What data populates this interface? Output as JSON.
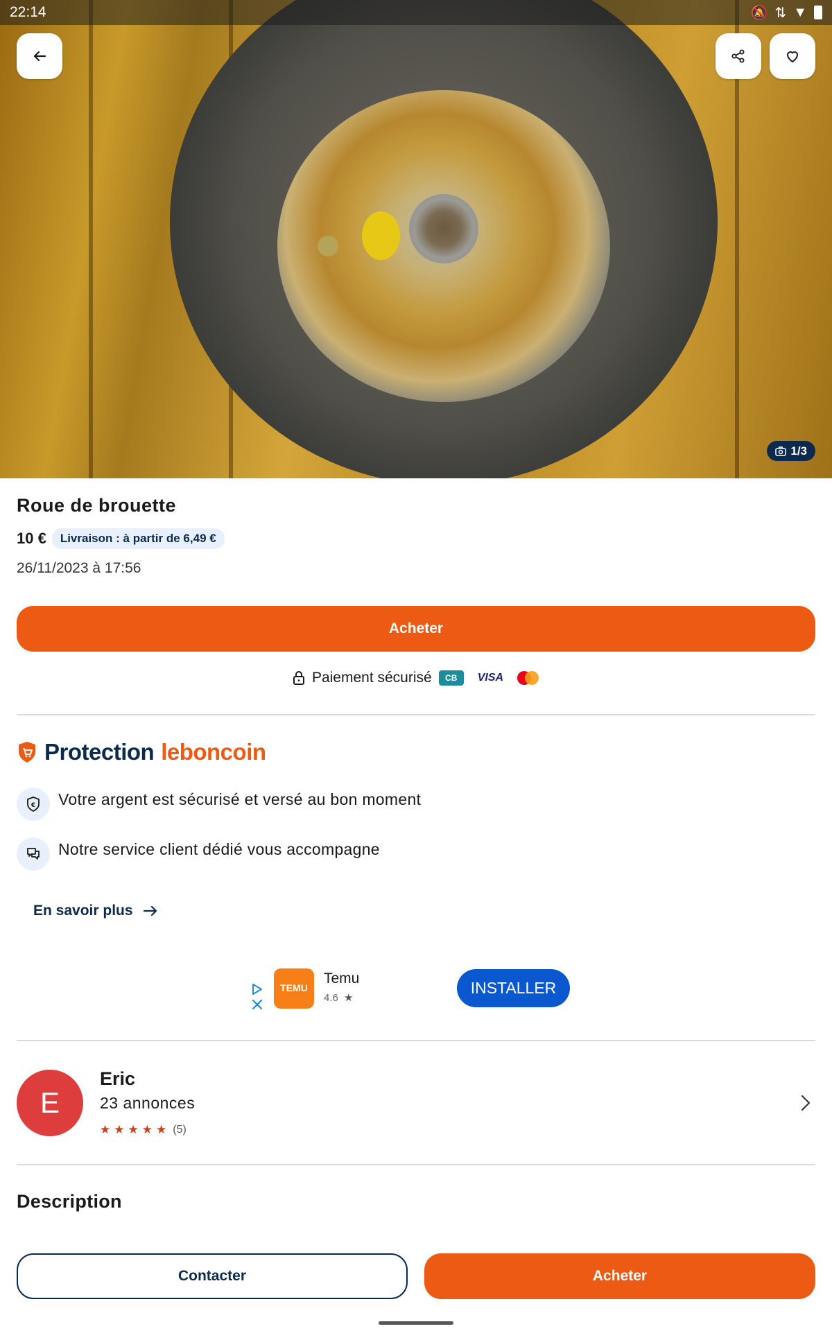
{
  "status_bar": {
    "time": "22:14"
  },
  "hero": {
    "photo_count": "1/3"
  },
  "listing": {
    "title": "Roue de brouette",
    "price": "10 €",
    "delivery": "Livraison : à partir de 6,49 €",
    "date": "26/11/2023 à 17:56"
  },
  "buy_button_label": "Acheter",
  "payment": {
    "label": "Paiement sécurisé",
    "cb": "CB",
    "visa": "VISA"
  },
  "protection": {
    "title_part1": "Protection",
    "title_part2": "leboncoin",
    "items": [
      {
        "icon": "euro-shield-icon",
        "text": "Votre argent est sécurisé et versé au bon moment"
      },
      {
        "icon": "chat-icon",
        "text": "Notre service client dédié vous accompagne"
      }
    ],
    "learn_more": "En savoir plus"
  },
  "ad": {
    "app_name": "Temu",
    "rating": "4.6",
    "logo_text": "TEMU",
    "install_label": "INSTALLER"
  },
  "seller": {
    "initial": "E",
    "name": "Eric",
    "ads_count": "23 annonces",
    "stars": 5,
    "reviews": "(5)"
  },
  "description_heading": "Description",
  "bottom_bar": {
    "contact_label": "Contacter",
    "buy_label": "Acheter"
  },
  "colors": {
    "brand_orange": "#ec5a13",
    "navy": "#0c2a4d",
    "install_blue": "#0b57d0"
  }
}
